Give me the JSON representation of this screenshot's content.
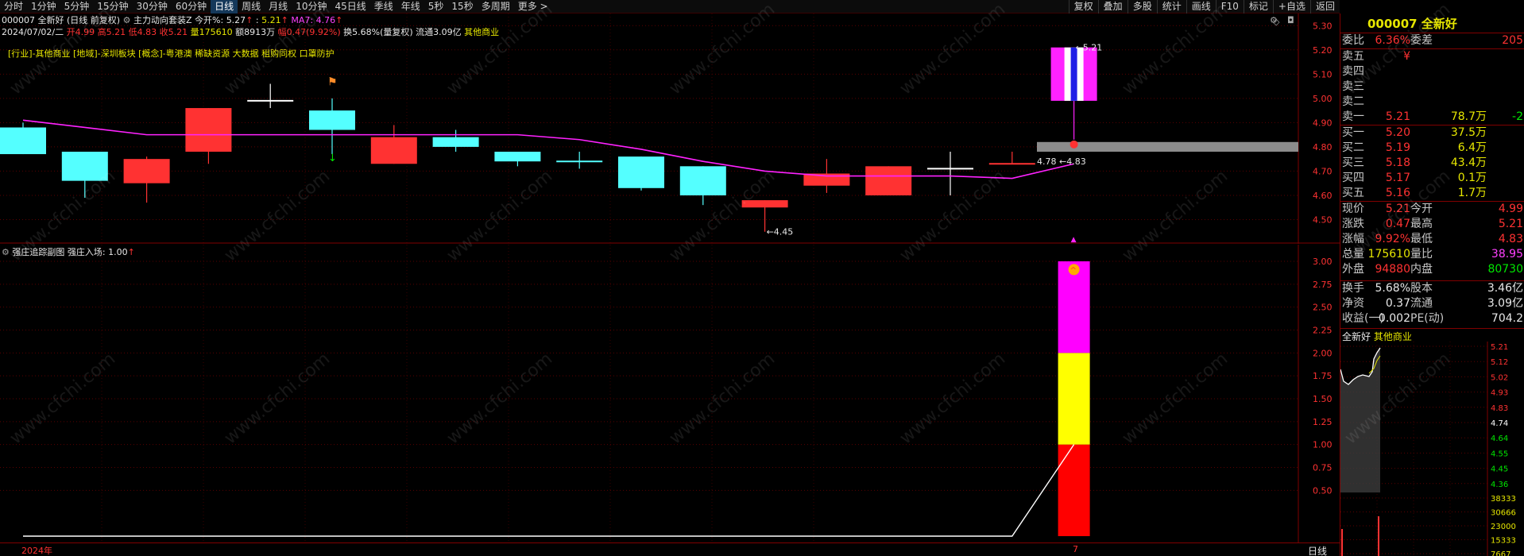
{
  "toolbar": {
    "periods": [
      "分时",
      "1分钟",
      "5分钟",
      "15分钟",
      "30分钟",
      "60分钟",
      "日线",
      "周线",
      "月线",
      "10分钟",
      "45日线",
      "季线",
      "年线",
      "5秒",
      "15秒",
      "多周期",
      "更多 >"
    ],
    "active_period": "日线",
    "tools": [
      "复权",
      "叠加",
      "多股",
      "统计",
      "画线",
      "F10",
      "标记",
      "+自选",
      "返回"
    ]
  },
  "header": {
    "code_name": "000007 全新好",
    "adj": "(日线 前复权)",
    "indicator": "主力动向套装Z",
    "today_open_label": "今开%:",
    "today_open_val": "5.27",
    "price_label": ":",
    "price_val": "5.21",
    "ma_label": "MA7:",
    "ma_val": "4.76"
  },
  "ohlc_line": {
    "date": "2024/07/02/二",
    "open_label": "开",
    "open": "4.99",
    "high_label": "高",
    "high": "5.21",
    "low_label": "低",
    "low": "4.83",
    "close_label": "收",
    "close": "5.21",
    "vol_label": "量",
    "vol": "175610",
    "amount_label": "额",
    "amount": "8913万",
    "chg_label": "幅",
    "chg": "0.47(9.92%)",
    "turnover": "换5.68%(量复权)",
    "float_cap": "流通3.09亿",
    "sector": "其他商业"
  },
  "concepts": "[行业]-其他商业 [地域]-深圳板块 [概念]-粤港澳 稀缺资源 大数据 租购同权 口罩防护",
  "main_chart": {
    "y_ticks": [
      "5.30",
      "5.20",
      "5.10",
      "5.00",
      "4.90",
      "4.80",
      "4.70",
      "4.60",
      "4.50"
    ],
    "annotations": {
      "high": "5.21",
      "low": "4.45",
      "ma_mark": "4.78",
      "ma_mark2": "4.83"
    },
    "candles": [
      {
        "o": 4.77,
        "c": 4.88,
        "h": 4.9,
        "l": 4.77,
        "color": "cyan"
      },
      {
        "o": 4.78,
        "c": 4.66,
        "h": 4.78,
        "l": 4.59,
        "color": "cyan"
      },
      {
        "o": 4.65,
        "c": 4.75,
        "h": 4.76,
        "l": 4.57,
        "color": "red"
      },
      {
        "o": 4.78,
        "c": 4.96,
        "h": 4.96,
        "l": 4.73,
        "color": "red"
      },
      {
        "o": 4.99,
        "c": 4.99,
        "h": 5.06,
        "l": 4.96,
        "color": "white"
      },
      {
        "o": 4.95,
        "c": 4.87,
        "h": 5.0,
        "l": 4.77,
        "color": "cyan"
      },
      {
        "o": 4.73,
        "c": 4.84,
        "h": 4.89,
        "l": 4.73,
        "color": "red"
      },
      {
        "o": 4.84,
        "c": 4.8,
        "h": 4.87,
        "l": 4.78,
        "color": "cyan"
      },
      {
        "o": 4.78,
        "c": 4.74,
        "h": 4.78,
        "l": 4.72,
        "color": "cyan"
      },
      {
        "o": 4.74,
        "c": 4.74,
        "h": 4.78,
        "l": 4.71,
        "color": "cyan"
      },
      {
        "o": 4.76,
        "c": 4.63,
        "h": 4.76,
        "l": 4.62,
        "color": "cyan"
      },
      {
        "o": 4.72,
        "c": 4.6,
        "h": 4.72,
        "l": 4.56,
        "color": "cyan"
      },
      {
        "o": 4.55,
        "c": 4.58,
        "h": 4.58,
        "l": 4.45,
        "color": "red"
      },
      {
        "o": 4.64,
        "c": 4.69,
        "h": 4.75,
        "l": 4.61,
        "color": "red"
      },
      {
        "o": 4.6,
        "c": 4.72,
        "h": 4.72,
        "l": 4.6,
        "color": "red"
      },
      {
        "o": 4.71,
        "c": 4.71,
        "h": 4.78,
        "l": 4.6,
        "color": "white"
      },
      {
        "o": 4.73,
        "c": 4.73,
        "h": 4.78,
        "l": 4.73,
        "color": "red"
      },
      {
        "o": 4.99,
        "c": 5.21,
        "h": 5.21,
        "l": 4.83,
        "color": "magenta"
      }
    ],
    "ma7": [
      4.91,
      4.88,
      4.85,
      4.85,
      4.85,
      4.85,
      4.85,
      4.85,
      4.85,
      4.83,
      4.79,
      4.74,
      4.7,
      4.68,
      4.68,
      4.68,
      4.67,
      4.73
    ]
  },
  "sub_chart": {
    "title": "强庄追踪副图",
    "line_label": "强庄入场:",
    "line_val": "1.00",
    "y_ticks": [
      "3.00",
      "2.75",
      "2.50",
      "2.25",
      "2.00",
      "1.75",
      "1.50",
      "1.25",
      "1.00",
      "0.75",
      "0.50"
    ],
    "values": [
      0,
      0,
      0,
      0,
      0,
      0,
      0,
      0,
      0,
      0,
      0,
      0,
      0,
      0,
      0,
      0,
      0,
      1.0
    ],
    "stack": [
      {
        "from": 0,
        "to": 1,
        "color": "#ff0000"
      },
      {
        "from": 1,
        "to": 2,
        "color": "#ffff00"
      },
      {
        "from": 2,
        "to": 3,
        "color": "#ff00ff"
      }
    ]
  },
  "footer": {
    "year_label": "2024年",
    "month_label": "7",
    "period_label": "日线"
  },
  "quote": {
    "title": "000007 全新好",
    "weibi_label": "委比",
    "weibi": "6.36%",
    "weicha_label": "委差",
    "weicha": "205",
    "sells": [
      {
        "label": "卖五",
        "price": "¥",
        "vol": "",
        "chg": ""
      },
      {
        "label": "卖四",
        "price": "",
        "vol": "",
        "chg": ""
      },
      {
        "label": "卖三",
        "price": "",
        "vol": "",
        "chg": ""
      },
      {
        "label": "卖二",
        "price": "",
        "vol": "",
        "chg": ""
      },
      {
        "label": "卖一",
        "price": "5.21",
        "vol": "78.7万",
        "chg": "-2"
      }
    ],
    "buys": [
      {
        "label": "买一",
        "price": "5.20",
        "vol": "37.5万"
      },
      {
        "label": "买二",
        "price": "5.19",
        "vol": "6.4万"
      },
      {
        "label": "买三",
        "price": "5.18",
        "vol": "43.4万"
      },
      {
        "label": "买四",
        "price": "5.17",
        "vol": "0.1万"
      },
      {
        "label": "买五",
        "price": "5.16",
        "vol": "1.7万"
      }
    ],
    "stats": [
      {
        "l1": "现价",
        "v1": "5.21",
        "c1": "#ff3232",
        "l2": "今开",
        "v2": "4.99",
        "c2": "#ff3232"
      },
      {
        "l1": "涨跌",
        "v1": "0.47",
        "c1": "#ff3232",
        "l2": "最高",
        "v2": "5.21",
        "c2": "#ff3232"
      },
      {
        "l1": "涨幅",
        "v1": "9.92%",
        "c1": "#ff3232",
        "l2": "最低",
        "v2": "4.83",
        "c2": "#ff3232"
      },
      {
        "l1": "总量",
        "v1": "175610",
        "c1": "#e6e600",
        "l2": "量比",
        "v2": "38.95",
        "c2": "#ff40ff"
      },
      {
        "l1": "外盘",
        "v1": "94880",
        "c1": "#ff3232",
        "l2": "内盘",
        "v2": "80730",
        "c2": "#00e600"
      }
    ],
    "stats2": [
      {
        "l1": "换手",
        "v1": "5.68%",
        "l2": "股本",
        "v2": "3.46亿"
      },
      {
        "l1": "净资",
        "v1": "0.37",
        "l2": "流通",
        "v2": "3.09亿"
      },
      {
        "l1": "收益(一)",
        "v1": "0.002",
        "l2": "PE(动)",
        "v2": "704.2"
      }
    ]
  },
  "mini": {
    "name": "全新好",
    "sector": "其他商业",
    "price_ticks": [
      "5.21",
      "5.12",
      "5.02",
      "4.93",
      "4.83",
      "4.74",
      "4.64",
      "4.55",
      "4.45",
      "4.36"
    ],
    "vol_ticks": [
      "38333",
      "30666",
      "23000",
      "15333",
      "7667"
    ]
  },
  "watermark": "www.cfchi.com",
  "colors": {
    "up": "#ff3232",
    "down": "#54ffff",
    "ma": "#ff22ff",
    "grid": "#800000"
  }
}
